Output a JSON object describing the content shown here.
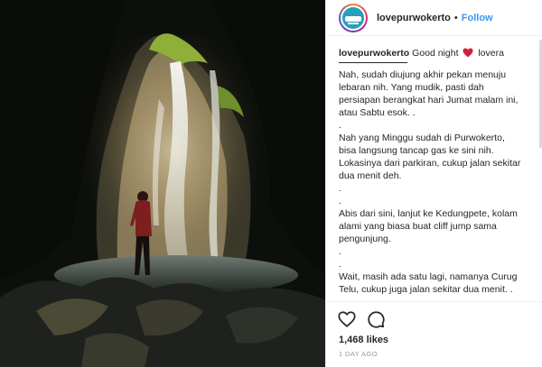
{
  "post": {
    "account": {
      "username": "lovepurwokerto",
      "separator": "•",
      "follow_label": "Follow",
      "avatar_icon": "lovepurwokerto-logo-icon"
    },
    "caption": {
      "username": "lovepurwokerto",
      "lead_before": "Good night",
      "emoji": "red-heart-icon",
      "lead_after": "lovera",
      "lines": [
        "Nah, sudah diujung akhir pekan menuju",
        "lebaran nih. Yang mudik, pasti dah",
        "persiapan berangkat hari Jumat malam ini,",
        "atau Sabtu esok. .",
        ".",
        "Nah yang Minggu sudah di Purwokerto,",
        "bisa langsung tancap gas ke sini nih.",
        "Lokasinya dari parkiran, cukup jalan sekitar",
        "dua menit deh.",
        ".",
        ".",
        "Abis dari sini, lanjut ke Kedungpete, kolam",
        "alami yang biasa buat cliff jump sama",
        "pengunjung.",
        ".",
        ".",
        "Wait, masih ada satu lagi, namanya Curug",
        "Telu, cukup juga jalan sekitar dua menit. ."
      ]
    },
    "actions": {
      "like_icon": "heart-outline-icon",
      "comment_icon": "comment-bubble-icon"
    },
    "likes": "1,468 likes",
    "time_ago": "1 DAY AGO",
    "colors": {
      "link": "#3897f0",
      "text": "#262626",
      "muted": "#999999",
      "heart": "#ed4956"
    }
  }
}
